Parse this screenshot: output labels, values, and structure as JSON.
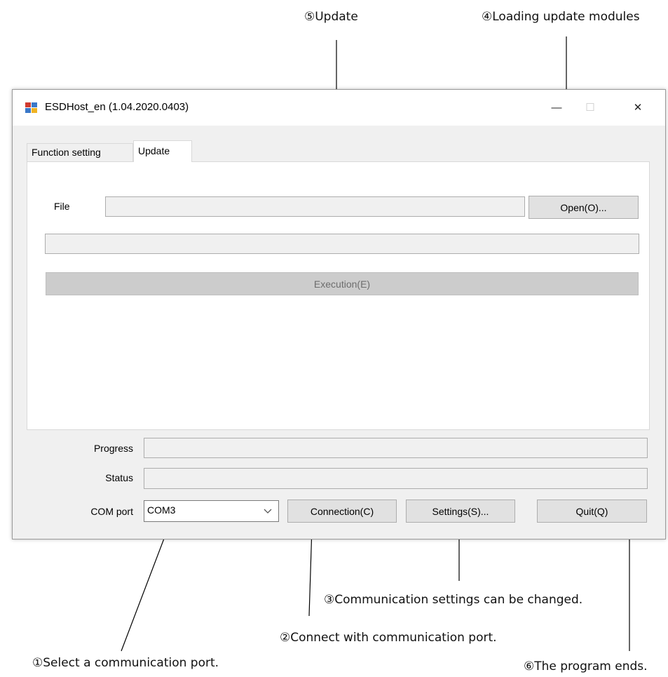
{
  "callouts": {
    "update": "⑤Update",
    "loading": "④Loading update modules",
    "comm_settings": "③Communication settings can be changed.",
    "connect": "②Connect with communication port.",
    "select_port": "①Select a communication port.",
    "program_ends": "⑥The program ends."
  },
  "window": {
    "title": "ESDHost_en (1.04.2020.0403)",
    "icon": "app-icon",
    "controls": {
      "minimize": "—",
      "maximize": "☐",
      "close": "✕"
    }
  },
  "tabs": [
    {
      "label": "Function setting",
      "active": false
    },
    {
      "label": "Update",
      "active": true
    }
  ],
  "update_tab": {
    "file_label": "File",
    "file_value": "",
    "open_button": "Open(O)...",
    "path_value": "",
    "execute_button": "Execution(E)"
  },
  "bottom": {
    "progress_label": "Progress",
    "progress_value": 0,
    "status_label": "Status",
    "status_value": "",
    "comport_label": "COM port",
    "comport_selected": "COM3",
    "connect_button": "Connection(C)",
    "settings_button": "Settings(S)...",
    "quit_button": "Quit(Q)"
  }
}
